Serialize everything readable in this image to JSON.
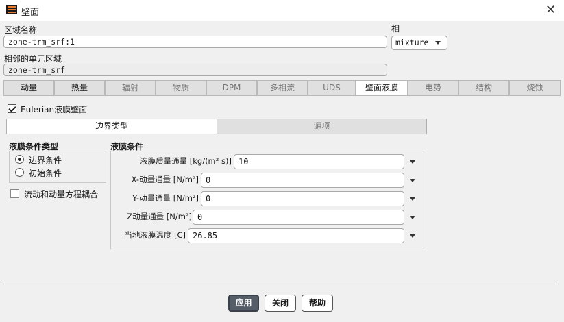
{
  "window": {
    "title": "壁面"
  },
  "zone": {
    "label": "区域名称",
    "value": "zone-trm_srf:1"
  },
  "phase": {
    "label": "相",
    "value": "mixture"
  },
  "adjacent": {
    "label": "相邻的单元区域",
    "value": "zone-trm_srf"
  },
  "tabs": [
    "动量",
    "热量",
    "辐射",
    "物质",
    "DPM",
    "多相流",
    "UDS",
    "壁面液膜",
    "电势",
    "结构",
    "烧蚀"
  ],
  "active_tab": "壁面液膜",
  "eulerian": {
    "label": "Eulerian液膜壁面",
    "checked": true
  },
  "subtabs": {
    "boundary_type": "边界类型",
    "source": "源项"
  },
  "film_condition_type": {
    "title": "液膜条件类型",
    "options": [
      "边界条件",
      "初始条件"
    ],
    "selected": "边界条件"
  },
  "coupling": {
    "label": "流动和动量方程耦合",
    "checked": false
  },
  "film_conditions": {
    "title": "液膜条件",
    "fields": [
      {
        "label": "液膜质量通量 [kg/(m² s)]",
        "value": "10"
      },
      {
        "label": "X-动量通量 [N/m²]",
        "value": "0"
      },
      {
        "label": "Y-动量通量 [N/m²]",
        "value": "0"
      },
      {
        "label": "Z动量通量 [N/m²]",
        "value": "0"
      },
      {
        "label": "当地液膜温度 [C]",
        "value": "26.85"
      }
    ]
  },
  "buttons": {
    "apply": "应用",
    "close": "关闭",
    "help": "帮助"
  },
  "colors": {
    "primary_button": "#555d68",
    "accent_icon": "#e8792b"
  }
}
